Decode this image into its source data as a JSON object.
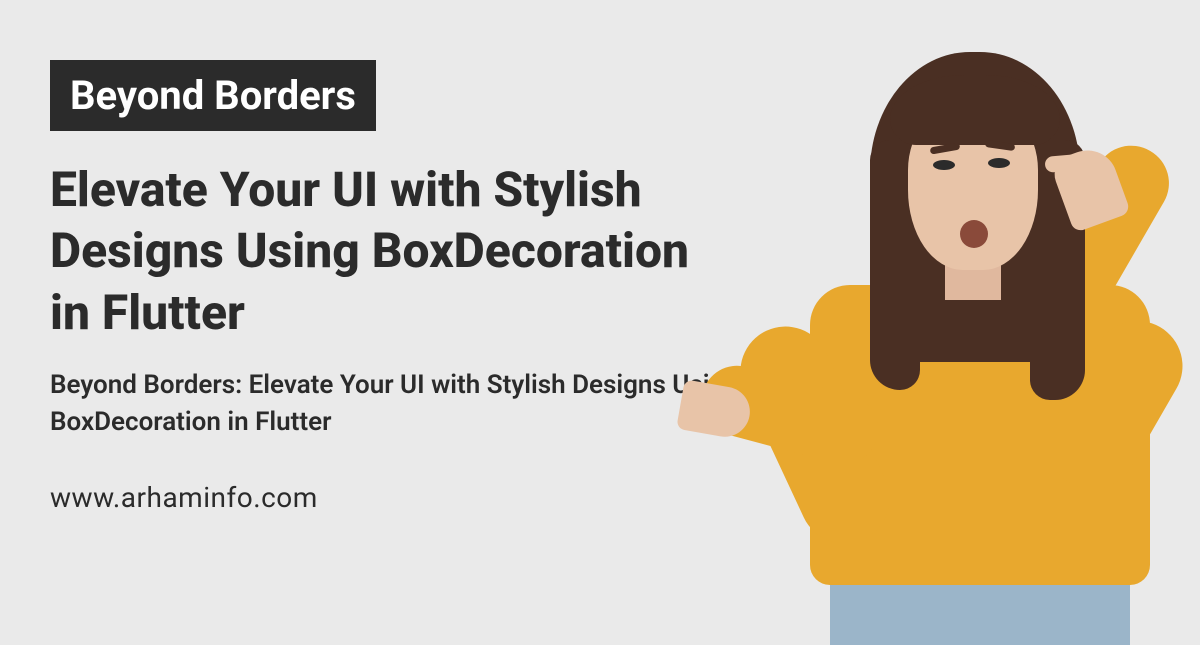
{
  "badge": "Beyond Borders",
  "heading": "Elevate Your UI with Stylish Designs Using BoxDecoration in Flutter",
  "subheading": "Beyond Borders: Elevate Your UI with Stylish Designs Using BoxDecoration in Flutter",
  "url": "www.arhaminfo.com",
  "image_alt": "Woman in mustard sweater pointing left"
}
